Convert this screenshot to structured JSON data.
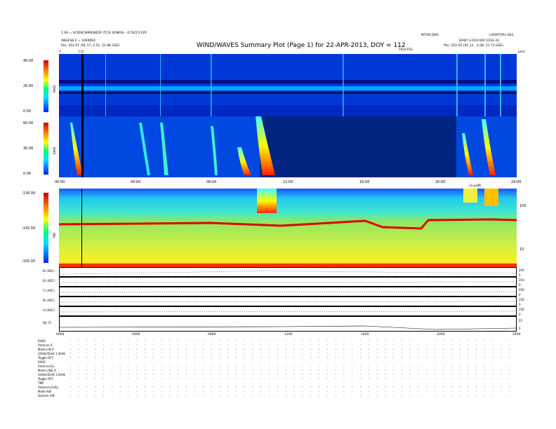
{
  "header": {
    "title": "WIND/WAVES Summary Plot (Page 1) for 22-APR-2013, DOY = 112",
    "left_line1": "1 S9 = SCIDSCI8PAD8E2P (TCIS SONRS) - 0.FSCF3.EPC",
    "left_line2": "ANGFS8 2 = 1004962",
    "left_line3": "Pos.    252.07 (91.17, 2.51, 21.86 GSE)",
    "right_line1": "NFOSCDAS",
    "right_line2": "DAILY  3.019.040.1033.33",
    "right_line3": "Pos.    252.02 (91.12, -1.08, 21.73 GSE)",
    "far_right_label": "LIS30TOP.s.0b1",
    "mid_right_label": "TIEU-T63",
    "cal_label": "Cal",
    "corner_left": "Y",
    "corner_right": "pm1"
  },
  "panels": {
    "rad2": {
      "name": "RAD2",
      "ticks": [
        "40.00",
        "20.00",
        "0.00"
      ]
    },
    "rad1": {
      "name": "RAD1",
      "ticks": [
        "60.00",
        "30.00",
        "0.00"
      ]
    },
    "tnr": {
      "name": "TNR",
      "ticks": [
        "-130.00",
        "-142.50",
        "-155.00"
      ],
      "right_ticks": [
        "100",
        "10"
      ]
    },
    "colorbar_top": "ca-p-BK",
    "time_axis": [
      "00:00",
      "04:00",
      "08:00",
      "12:00",
      "16:00",
      "20:00",
      "24:00"
    ],
    "time_axis_bottom": [
      "0000",
      "0400",
      "0800",
      "1200",
      "1600",
      "2000",
      "2400"
    ],
    "strips": [
      {
        "label": "Bi (ADC)",
        "right": [
          "250",
          "0"
        ]
      },
      {
        "label": "Bi (ADC)",
        "right": [
          "250",
          "0"
        ]
      },
      {
        "label": "Ci (ADC)",
        "right": [
          "250",
          "0"
        ]
      },
      {
        "label": "Bi (ADC)",
        "right": [
          "250",
          "0"
        ]
      },
      {
        "label": "Ai (ADC)",
        "right": [
          "250",
          "0"
        ]
      },
      {
        "label": "|B| (T)",
        "right": [
          "25",
          "0"
        ]
      }
    ]
  },
  "footer": {
    "rad2": [
      "RAD2",
      "Antenna    S",
      "Mode    LIN 0",
      "32kHz/5kHz  1.0kHz",
      "Toggle     OFF"
    ],
    "rad1": [
      "RAD1",
      "Antenna    Ex",
      "Mode    LIN2_A",
      "32kHz/5kHz  1.0kHz",
      "Toggle     OFF"
    ],
    "tnr": [
      "TNR",
      "Antenna   Ex/Ey",
      "Mode    A/B",
      "Domain    A/B"
    ]
  },
  "colors": {
    "cb_red": "#c80000",
    "cb_yellow": "#ffff00",
    "cb_green": "#00ff80",
    "cb_cyan": "#00e0ff",
    "cb_blue": "#0020ff",
    "bg_blue": "#0038d8",
    "tnr_green": "#90e860",
    "tnr_yellow": "#f0f020",
    "tnr_cyan": "#20e0e0",
    "red_band": "#e00000"
  },
  "chart_data": {
    "type": "heatmap",
    "title": "WIND/WAVES Summary Plot (Page 1) for 22-APR-2013, DOY = 112",
    "x_range": [
      "00:00",
      "24:00"
    ],
    "panels": [
      {
        "name": "RAD2",
        "y_range": [
          0,
          40
        ]
      },
      {
        "name": "RAD1",
        "y_range": [
          0,
          60
        ]
      },
      {
        "name": "TNR",
        "y_range": [
          -155,
          -130
        ]
      }
    ]
  }
}
